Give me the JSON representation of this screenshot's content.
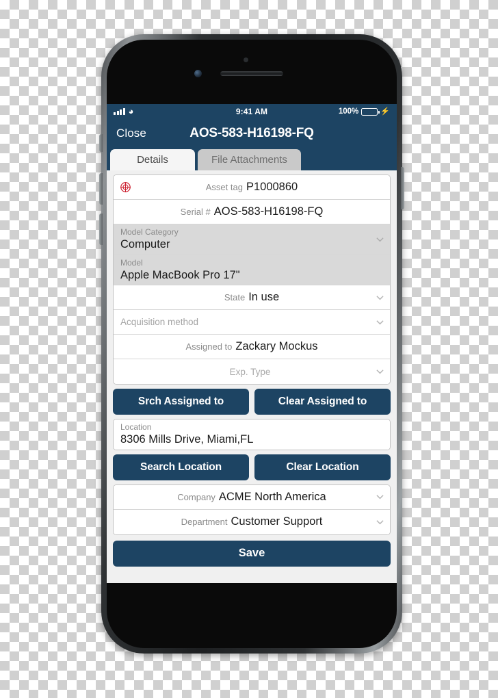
{
  "status_bar": {
    "time": "9:41 AM",
    "battery_percent": "100%",
    "signal_icon": "cellular-signal-icon",
    "wifi_icon": "wifi-icon",
    "battery_icon": "battery-icon",
    "charging_icon": "lightning-bolt-icon"
  },
  "nav": {
    "close_label": "Close",
    "title": "AOS-583-H16198-FQ"
  },
  "tabs": [
    {
      "label": "Details",
      "active": true
    },
    {
      "label": "File Attachments",
      "active": false
    }
  ],
  "form": {
    "asset_tag": {
      "label": "Asset tag",
      "value": "P1000860",
      "icon": "barcode-scan-target-icon"
    },
    "serial": {
      "label": "Serial #",
      "value": "AOS-583-H16198-FQ"
    },
    "model_category": {
      "label": "Model Category",
      "value": "Computer"
    },
    "model": {
      "label": "Model",
      "value": "Apple MacBook Pro 17\""
    },
    "state": {
      "label": "State",
      "value": "In use"
    },
    "acquisition_method": {
      "label": "Acquisition method",
      "value": ""
    },
    "assigned_to": {
      "label": "Assigned to",
      "value": "Zackary Mockus"
    },
    "exp_type": {
      "label": "Exp. Type",
      "value": ""
    },
    "location": {
      "label": "Location",
      "value": "8306 Mills Drive, Miami,FL"
    },
    "company": {
      "label": "Company",
      "value": "ACME North America"
    },
    "department": {
      "label": "Department",
      "value": "Customer Support"
    }
  },
  "buttons": {
    "search_assigned_to": "Srch Assigned to",
    "clear_assigned_to": "Clear Assigned to",
    "search_location": "Search Location",
    "clear_location": "Clear Location",
    "save": "Save"
  },
  "colors": {
    "navy": "#1d4463",
    "tab_active_bg": "#f5f5f5",
    "tab_inactive_bg": "#c9c9c9",
    "row_gray": "#d9d9d9",
    "battery_green": "#4cd964",
    "scan_icon_red": "#cc1f2e"
  }
}
